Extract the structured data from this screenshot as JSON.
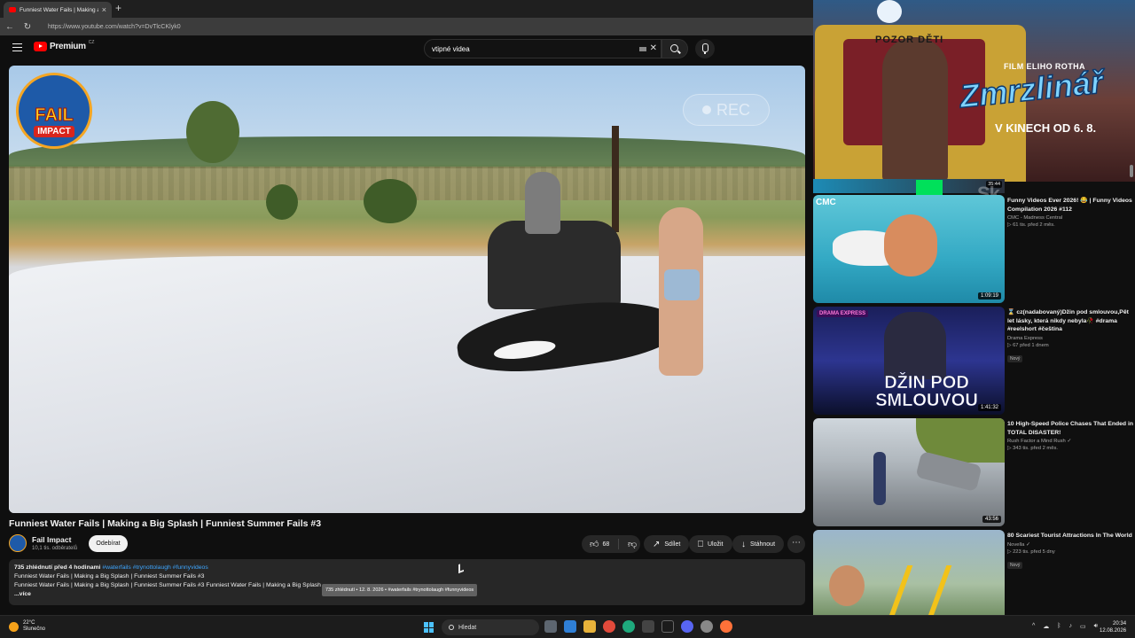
{
  "browser": {
    "tab_title": "Funniest Water Fails | Making a Big Splash",
    "url": "https://www.youtube.com/watch?v=DvTlcCKlyk0"
  },
  "youtube": {
    "logo_text": "Premium",
    "logo_country": "CZ",
    "search_value": "vtipné videa"
  },
  "video": {
    "channel_badge_top": "FAIL",
    "channel_badge_bottom": "IMPACT",
    "rec_label": "REC",
    "title": "Funniest Water Fails | Making a Big Splash | Funniest Summer Fails #3",
    "channel_name": "Fail Impact",
    "subscribers": "10,1 tis. odběratelů",
    "subscribe_label": "Odebírat",
    "likes": "68",
    "share_label": "Sdílet",
    "save_label": "Uložit",
    "download_label": "Stáhnout"
  },
  "description": {
    "views_time": "735 zhlédnutí  před 4 hodinami",
    "tags": "#waterfails #trynottolaugh #funnyvideos",
    "line2": "Funniest Water Fails | Making a Big Splash | Funniest Summer Fails #3",
    "line3": "Funniest Water Fails | Making a Big Splash | Funniest Summer Fails #3 Funniest Water Fails | Making a Big Splash",
    "more": "...více",
    "tooltip": "735 zhlédnutí • 12. 8. 2026 • #waterfails #trynottolaugh #funnyvideos"
  },
  "ad": {
    "sign": "POZOR DĚTI",
    "film_label": "FILM ELIHO ROTHA",
    "movie_title": "Zmrzlinář",
    "release": "V KINECH OD 6. 8.",
    "duration": "35:44",
    "overlay_text": "Sk"
  },
  "recommendations": [
    {
      "title": "Funny Videos Ever 2026! 😂 | Funny Videos Compilation 2026 #112",
      "channel": "CMC - Madness Central",
      "stats": "▷ 61 tis.  před 2 měs.",
      "duration": "1:09:19",
      "thumb_label": "CMC",
      "badge": ""
    },
    {
      "title": "⌛ cz(nadabovaný)Džin pod smlouvou,Pět let lásky, která nikdy nebyla🥀 #drama #reelshort #čeština",
      "channel": "Drama Express",
      "stats": "▷ 67  před 1 dnem",
      "duration": "1:41:32",
      "thumb_label": "DŽIN POD SMLOUVOU",
      "thumb_tag": "DRAMA EXPRESS",
      "badge": "Nový"
    },
    {
      "title": "10 High-Speed Police Chases That Ended in TOTAL DISASTER!",
      "channel": "Rush Factor a Mind Rush ✓",
      "stats": "▷ 343 tis.  před 2 měs.",
      "duration": "43:56",
      "badge": ""
    },
    {
      "title": "80 Scariest Tourist Attractions In The World",
      "channel": "Novella ✓",
      "stats": "▷ 223 tis.  před 5 dny",
      "duration": "",
      "badge": "Nový"
    }
  ],
  "taskbar": {
    "temperature": "22°C",
    "weather": "Slunečno",
    "search_label": "Hledat",
    "time": "20:34",
    "date": "12.08.2026"
  }
}
